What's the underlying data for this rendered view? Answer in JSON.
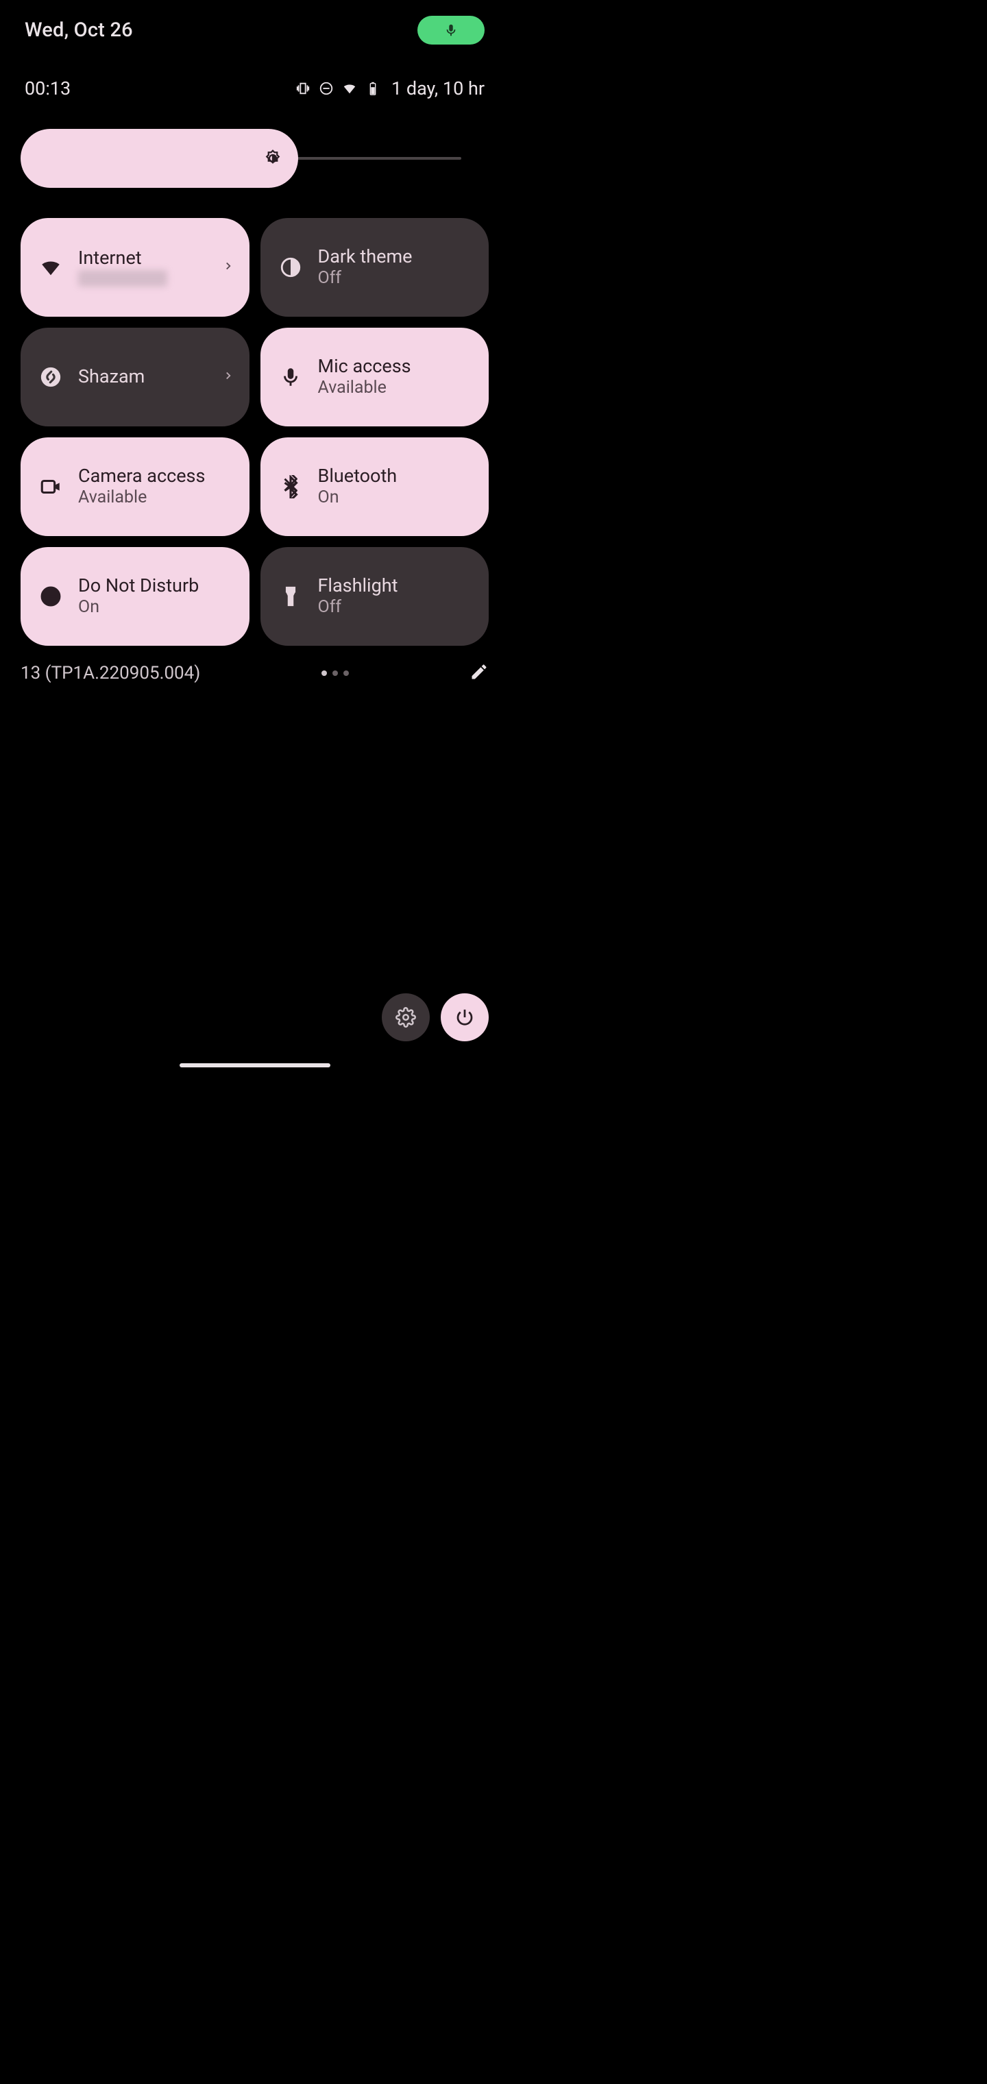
{
  "header": {
    "date": "Wed, Oct 26"
  },
  "status": {
    "time": "00:13",
    "battery_text": "1 day, 10 hr"
  },
  "brightness": {
    "percent": 62
  },
  "tiles": [
    {
      "id": "internet",
      "title": "Internet",
      "sub": "",
      "state": "on",
      "icon": "wifi",
      "chevron": true,
      "sub_blur": true
    },
    {
      "id": "dark-theme",
      "title": "Dark theme",
      "sub": "Off",
      "state": "off",
      "icon": "half-circle",
      "chevron": false
    },
    {
      "id": "shazam",
      "title": "Shazam",
      "sub": "",
      "state": "off",
      "icon": "shazam",
      "chevron": true,
      "single": true
    },
    {
      "id": "mic-access",
      "title": "Mic access",
      "sub": "Available",
      "state": "on",
      "icon": "mic",
      "chevron": false
    },
    {
      "id": "camera-access",
      "title": "Camera access",
      "sub": "Available",
      "state": "on",
      "icon": "camera",
      "chevron": false
    },
    {
      "id": "bluetooth",
      "title": "Bluetooth",
      "sub": "On",
      "state": "on",
      "icon": "bluetooth",
      "chevron": false
    },
    {
      "id": "dnd",
      "title": "Do Not Disturb",
      "sub": "On",
      "state": "on",
      "icon": "dnd",
      "chevron": false
    },
    {
      "id": "flashlight",
      "title": "Flashlight",
      "sub": "Off",
      "state": "off",
      "icon": "flashlight",
      "chevron": false
    }
  ],
  "footer": {
    "build": "13 (TP1A.220905.004)",
    "page_count": 3,
    "active_page": 0
  }
}
